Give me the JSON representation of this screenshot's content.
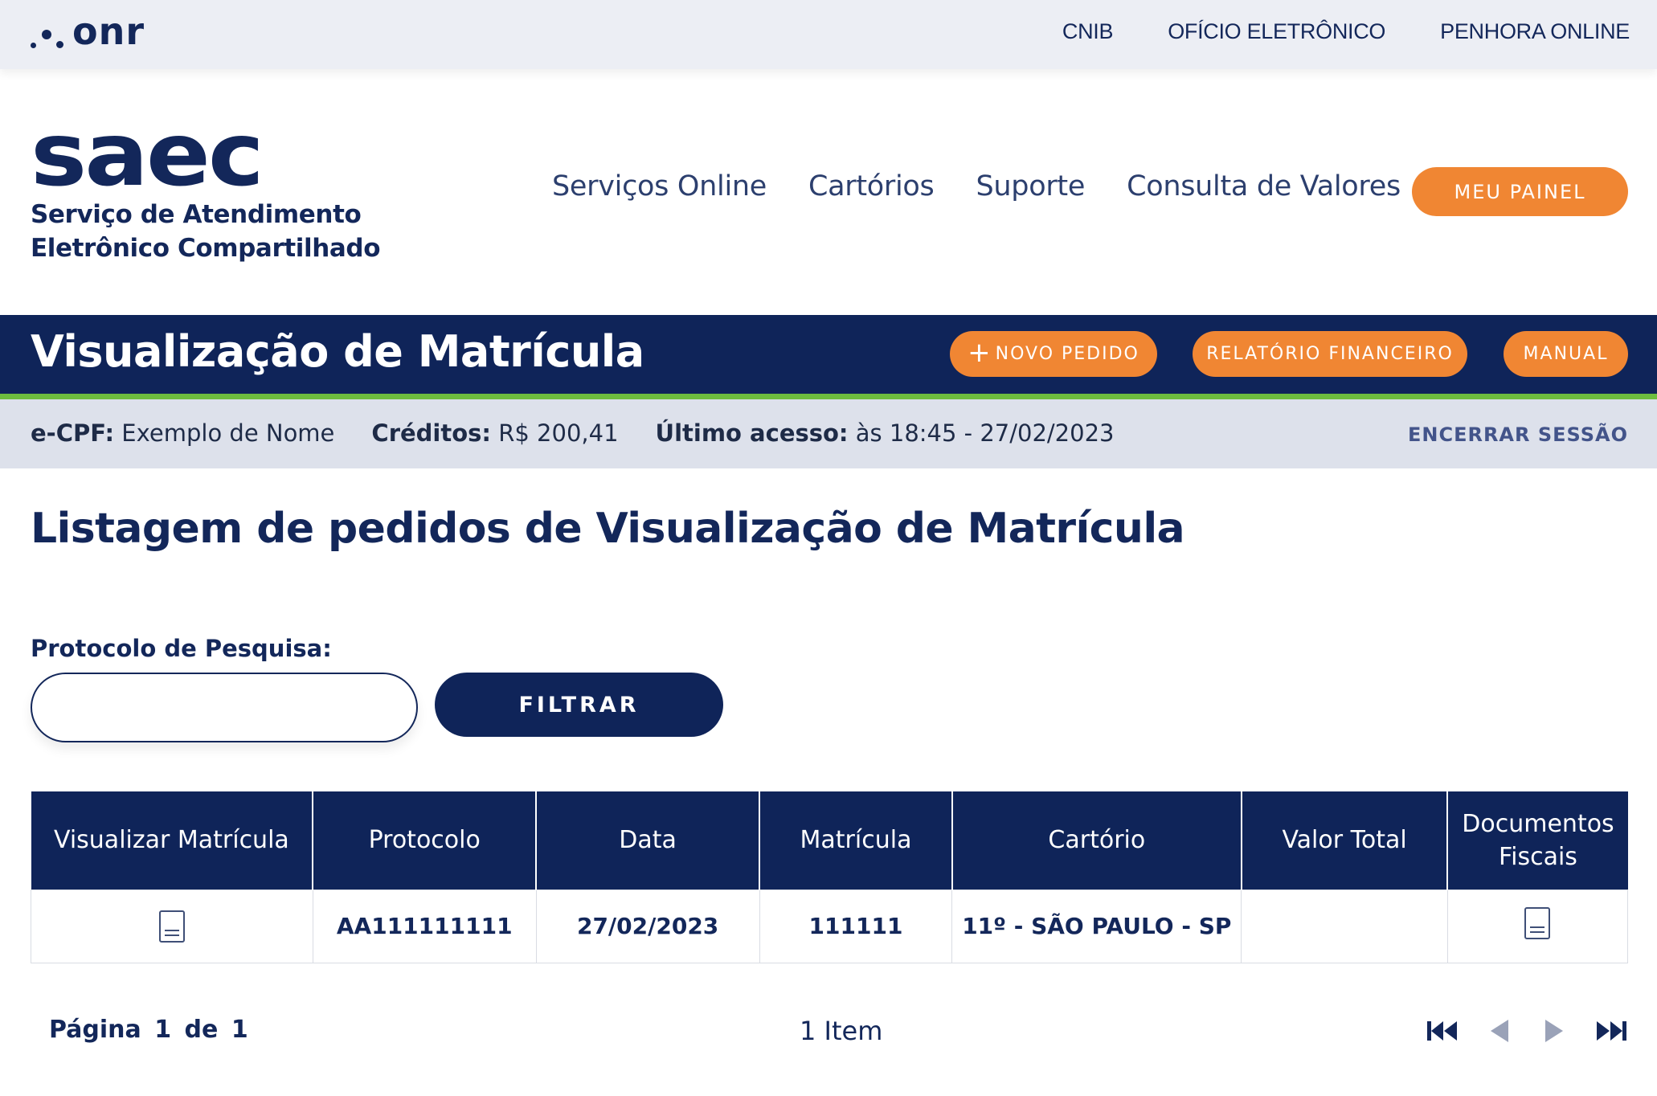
{
  "topbar": {
    "logo_text": "onr",
    "links": [
      "CNIB",
      "OFÍCIO ELETRÔNICO",
      "PENHORA ONLINE"
    ]
  },
  "header": {
    "logo_text": "saec",
    "logo_subtitle": "Serviço de Atendimento Eletrônico Compartilhado",
    "nav": [
      "Serviços Online",
      "Cartórios",
      "Suporte",
      "Consulta de Valores"
    ],
    "panel_button": "MEU PAINEL"
  },
  "titleband": {
    "title": "Visualização de Matrícula",
    "novo_pedido": "NOVO PEDIDO",
    "relatorio": "RELATÓRIO FINANCEIRO",
    "manual": "MANUAL"
  },
  "session": {
    "ecpf_label": "e-CPF:",
    "ecpf_value": "Exemplo de Nome",
    "creditos_label": "Créditos:",
    "creditos_value": "R$ 200,41",
    "acesso_label": "Último acesso:",
    "acesso_value": "às 18:45 - 27/02/2023",
    "logout": "ENCERRAR SESSÃO"
  },
  "content": {
    "title": "Listagem de pedidos de Visualização de Matrícula",
    "search_label": "Protocolo de Pesquisa:",
    "search_value": "",
    "filter_button": "FILTRAR"
  },
  "table": {
    "headers": [
      "Visualizar Matrícula",
      "Protocolo",
      "Data",
      "Matrícula",
      "Cartório",
      "Valor Total",
      "Documentos Fiscais"
    ],
    "rows": [
      {
        "protocolo": "AA111111111",
        "data": "27/02/2023",
        "matricula": "111111",
        "cartorio": "11º - SÃO PAULO - SP",
        "valor_total": ""
      }
    ]
  },
  "pagination": {
    "page_text": "Página 1  de  1",
    "items_text": "1 Item"
  },
  "colors": {
    "navy": "#0f2459",
    "orange": "#f08633",
    "green_accent": "#6dbd3f"
  }
}
